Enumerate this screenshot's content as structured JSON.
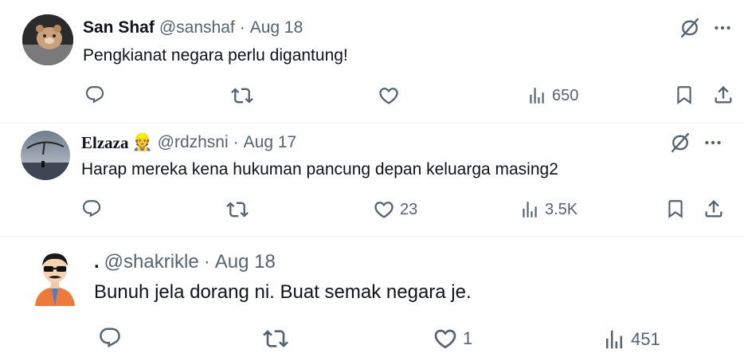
{
  "tweets": [
    {
      "name": "San Shaf",
      "handle": "@sanshaf",
      "sep": "·",
      "date": "Aug 18",
      "badge_emoji": "",
      "text": "Pengkianat negara perlu digantung!",
      "replies": "",
      "retweets": "",
      "likes": "",
      "views": "650"
    },
    {
      "name": "Elzaza",
      "handle": "@rdzhsni",
      "sep": "·",
      "date": "Aug 17",
      "badge_emoji": "👷",
      "text": "Harap mereka kena hukuman pancung depan keluarga masing2",
      "replies": "",
      "retweets": "",
      "likes": "23",
      "views": "3.5K"
    },
    {
      "name": ".",
      "handle": "@shakrikle",
      "sep": "·",
      "date": "Aug 18",
      "badge_emoji": "",
      "text": "Bunuh jela dorang ni. Buat semak negara je.",
      "replies": "",
      "retweets": "",
      "likes": "1",
      "views": "451"
    }
  ],
  "icons": {
    "reply": "reply-icon",
    "retweet": "retweet-icon",
    "like": "like-icon",
    "views": "views-icon",
    "bookmark": "bookmark-icon",
    "share": "share-icon",
    "grok": "grok-icon",
    "more": "more-icon"
  },
  "colors": {
    "text": "#0f1419",
    "secondary": "#536471",
    "divider": "#eff3f4"
  }
}
